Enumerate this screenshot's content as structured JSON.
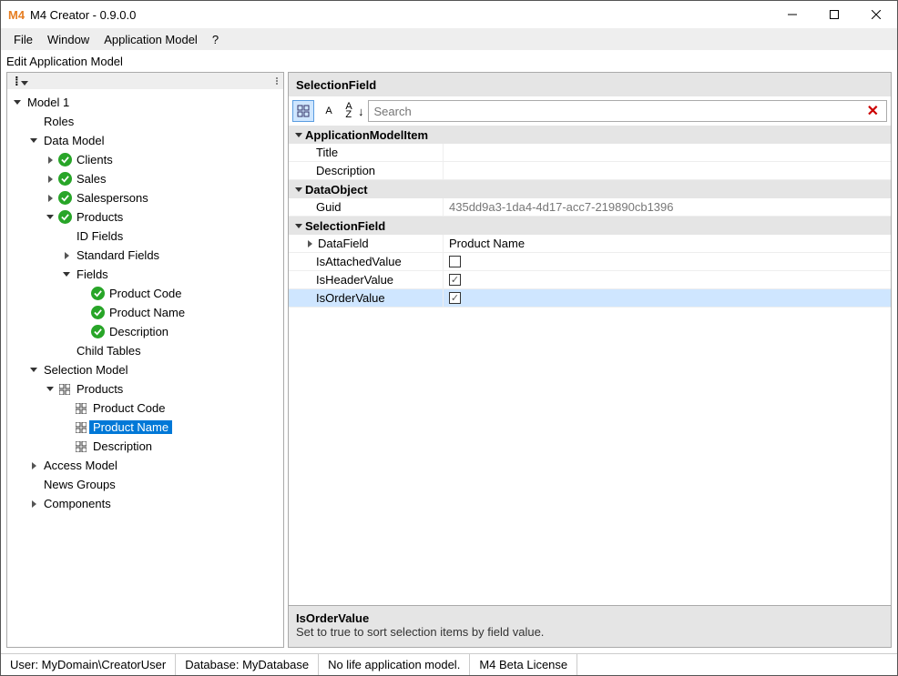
{
  "window": {
    "title": "M4 Creator - 0.9.0.0"
  },
  "menu": {
    "file": "File",
    "window": "Window",
    "appmodel": "Application Model",
    "help": "?"
  },
  "toolbar": {
    "label": "Edit Application Model"
  },
  "tree": {
    "root": "Model 1",
    "roles": "Roles",
    "dataModel": "Data Model",
    "clients": "Clients",
    "sales": "Sales",
    "salespersons": "Salespersons",
    "products": "Products",
    "idFields": "ID Fields",
    "standardFields": "Standard Fields",
    "fields": "Fields",
    "productCode": "Product Code",
    "productName": "Product Name",
    "description": "Description",
    "childTables": "Child Tables",
    "selectionModel": "Selection Model",
    "selProducts": "Products",
    "selProductCode": "Product Code",
    "selProductName": "Product Name",
    "selDescription": "Description",
    "accessModel": "Access Model",
    "newsGroups": "News Groups",
    "components": "Components"
  },
  "props": {
    "header": "SelectionField",
    "searchPlaceholder": "Search",
    "cat1": "ApplicationModelItem",
    "titleField": "Title",
    "descriptionField": "Description",
    "cat2": "DataObject",
    "guidField": "Guid",
    "guidValue": "435dd9a3-1da4-4d17-acc7-219890cb1396",
    "cat3": "SelectionField",
    "dataField": "DataField",
    "dataFieldValue": "Product Name",
    "isAttached": "IsAttachedValue",
    "isHeader": "IsHeaderValue",
    "isOrder": "IsOrderValue",
    "desc": {
      "title": "IsOrderValue",
      "text": "Set to true to sort selection items by field value."
    }
  },
  "status": {
    "user": "User: MyDomain\\CreatorUser",
    "db": "Database: MyDatabase",
    "life": "No life application model.",
    "license": "M4 Beta License"
  }
}
